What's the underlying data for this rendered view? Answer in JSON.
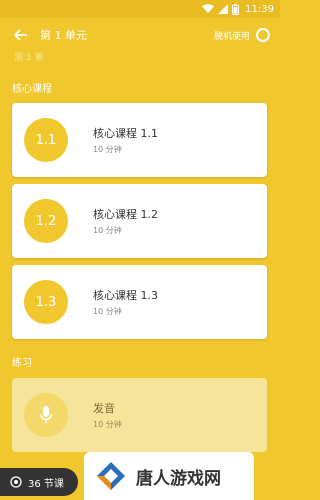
{
  "status_bar": {
    "time": "11:39"
  },
  "header": {
    "title": "第 1 单元",
    "offline_label": "脱机使用"
  },
  "faded_text": "测 1 第",
  "sections": {
    "core": "核心课程",
    "practice": "练习"
  },
  "core_lessons": [
    {
      "badge": "1.1",
      "title": "核心课程 1.1",
      "duration": "10 分钟"
    },
    {
      "badge": "1.2",
      "title": "核心课程 1.2",
      "duration": "10 分钟"
    },
    {
      "badge": "1.3",
      "title": "核心课程 1.3",
      "duration": "10 分钟"
    }
  ],
  "practice_items": [
    {
      "title": "发音",
      "duration": "10 分钟",
      "icon": "mic-icon"
    }
  ],
  "bottom_bar": {
    "lessons_count": "36 节课"
  },
  "watermark": {
    "text": "唐人游戏网"
  },
  "colors": {
    "accent": "#F1C72E",
    "card": "#FFFFFF"
  }
}
